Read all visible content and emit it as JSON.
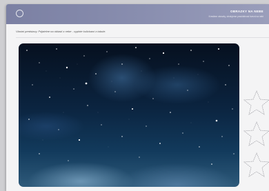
{
  "header": {
    "title": "OBRAZKY NA NEBE",
    "subtitle": "Kreslime obrazky, sledujeme pravidelnost hvezd na nebi"
  },
  "instruction": "Vlastni predstavy. Prijatelne na oblasti z nebe - vyplnte kulickami z tabule.",
  "icons": {
    "header_circle": "circle-icon",
    "moon": "crescent-moon-icon",
    "star_outline": "star-outline-icon"
  },
  "colors": {
    "header": "#8a8fb0",
    "sky_dark": "#06101f",
    "sky_light": "#2e5a7a",
    "moon": "#ffffff"
  }
}
